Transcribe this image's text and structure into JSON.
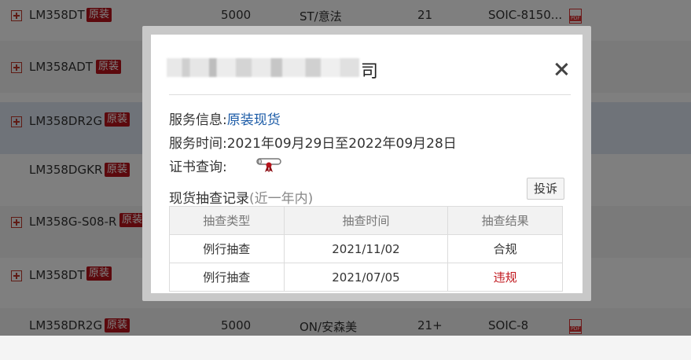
{
  "background_rows": [
    {
      "part": "LM358DT",
      "badge": "原装",
      "qty": "5000",
      "brand": "ST/意法",
      "dc": "21",
      "pkg": "SOIC-8150...",
      "expand": true,
      "pdf": true
    },
    {
      "part": "LM358ADT",
      "badge": "原装",
      "qty": "",
      "brand": "",
      "dc": "",
      "pkg": "",
      "expand": true,
      "pdf": false
    },
    {
      "part": "LM358DR2G",
      "badge": "原装",
      "qty": "",
      "brand": "",
      "dc": "",
      "pkg": "",
      "expand": true,
      "pdf": false
    },
    {
      "part": "LM358DGKR",
      "badge": "原装",
      "qty": "",
      "brand": "",
      "dc": "",
      "pkg": "",
      "expand": false,
      "pdf": false
    },
    {
      "part": "LM358G-S08-R",
      "badge": "原装",
      "qty": "",
      "brand": "",
      "dc": "",
      "pkg": "",
      "expand": true,
      "pdf": false
    },
    {
      "part": "LM358DT",
      "badge": "原装",
      "qty": "",
      "brand": "",
      "dc": "",
      "pkg": "",
      "expand": true,
      "pdf": false
    },
    {
      "part": "LM358DR2G",
      "badge": "原装",
      "qty": "5000",
      "brand": "ON/安森美",
      "dc": "21+",
      "pkg": "SOIC-8",
      "expand": false,
      "pdf": true
    }
  ],
  "pdf_label": "PDF",
  "modal": {
    "title_tail": "司",
    "service_info_label": "服务信息:",
    "service_info_value": "原装现货",
    "service_time_label": "服务时间:",
    "service_time_value": "2021年09月29日至2022年09月28日",
    "cert_label": "证书查询:",
    "section_title": "现货抽查记录",
    "section_sub": "(近一年内)",
    "complain_label": "投诉",
    "table": {
      "headers": [
        "抽查类型",
        "抽查时间",
        "抽查结果"
      ],
      "rows": [
        [
          "例行抽查",
          "2021/11/02",
          "合规"
        ],
        [
          "例行抽查",
          "2021/07/05",
          "违规"
        ]
      ]
    }
  },
  "colors": {
    "accent_link": "#1a5aa6",
    "violation": "#c0161c",
    "badge": "#b8121b"
  }
}
